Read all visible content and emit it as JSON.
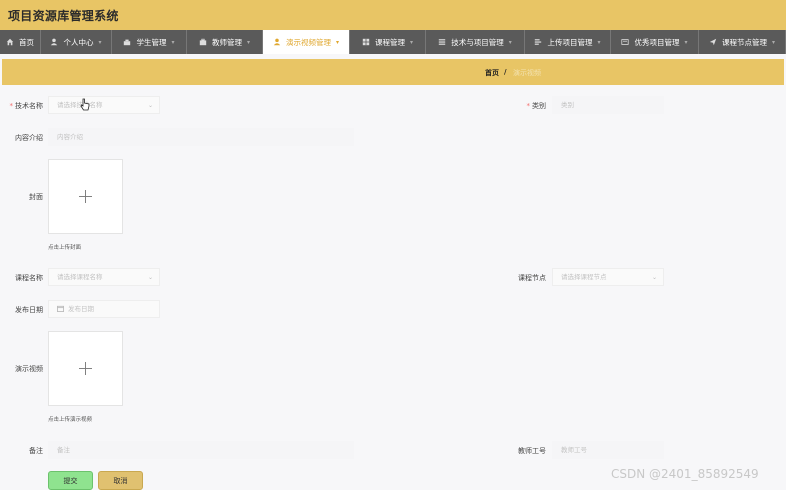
{
  "header": {
    "title": "项目资源库管理系统"
  },
  "nav": {
    "items": [
      {
        "label": "首页",
        "icon": "home-icon"
      },
      {
        "label": "个人中心",
        "icon": "user-icon"
      },
      {
        "label": "学生管理",
        "icon": "user-icon"
      },
      {
        "label": "教师管理",
        "icon": "briefcase-icon"
      },
      {
        "label": "演示视频管理",
        "icon": "user-icon",
        "active": true
      },
      {
        "label": "课程管理",
        "icon": "grid-icon"
      },
      {
        "label": "技术与项目管理",
        "icon": "list-icon"
      },
      {
        "label": "上传项目管理",
        "icon": "list-icon"
      },
      {
        "label": "优秀项目管理",
        "icon": "card-icon"
      },
      {
        "label": "课程节点管理",
        "icon": "send-icon"
      }
    ],
    "active_color": "#e0a830"
  },
  "breadcrumb": {
    "home": "首页",
    "separator": "/",
    "current": "演示视频"
  },
  "form": {
    "tech_name": {
      "label": "技术名称",
      "placeholder": "请选择技术名称"
    },
    "category": {
      "label": "类别",
      "placeholder": "类别"
    },
    "intro": {
      "label": "内容介绍",
      "placeholder": "内容介绍"
    },
    "cover": {
      "label": "封面",
      "hint": "点击上传封面"
    },
    "course_name": {
      "label": "课程名称",
      "placeholder": "请选择课程名称"
    },
    "course_node": {
      "label": "课程节点",
      "placeholder": "请选择课程节点"
    },
    "publish_date": {
      "label": "发布日期",
      "placeholder": "发布日期"
    },
    "video": {
      "label": "演示视频",
      "hint": "点击上传演示视频"
    },
    "remark": {
      "label": "备注",
      "placeholder": "备注"
    },
    "teacher_id": {
      "label": "教师工号",
      "placeholder": "教师工号"
    },
    "submit_label": "提交",
    "cancel_label": "取消"
  },
  "watermark": "CSDN @2401_85892549",
  "colors": {
    "header": "#e8c565",
    "nav": "#5a5a5a",
    "required": "#f56c6c",
    "submit": "#8fe38f",
    "cancel": "#e0c170"
  }
}
